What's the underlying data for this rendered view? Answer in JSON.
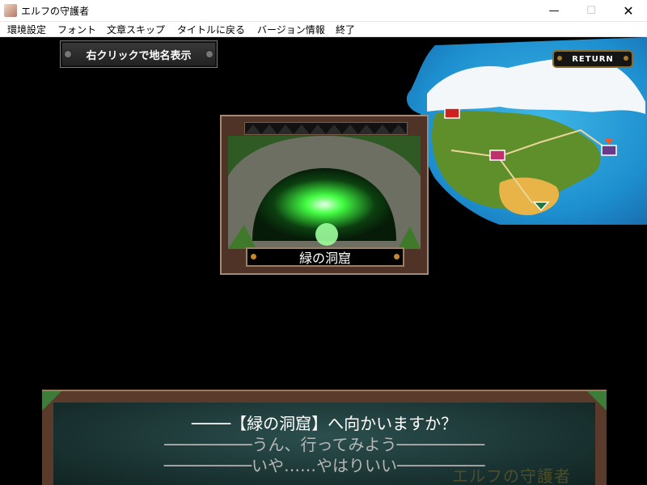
{
  "window": {
    "title": "エルフの守護者",
    "minimize_glyph": "—",
    "maximize_glyph": "☐",
    "close_glyph": "✕"
  },
  "menubar": {
    "items": [
      "環境設定",
      "フォント",
      "文章スキップ",
      "タイトルに戻る",
      "バージョン情報",
      "終了"
    ]
  },
  "game": {
    "hint_button": "右クリックで地名表示",
    "return_button": "RETURN",
    "location": {
      "name": "緑の洞窟"
    },
    "dialog": {
      "question": "────【緑の洞窟】へ向かいますか？",
      "choices": [
        "─────────うん、行ってみよう─────────",
        "─────────いや……やはりいい─────────"
      ],
      "watermark": "エルフの守護者"
    }
  },
  "colors": {
    "background": "#000000",
    "frame_brown": "#5a3a2a",
    "dialog_teal": "#1d3a39",
    "choice_text": "#b7b7b7",
    "cave_glow": "#44ff44"
  }
}
